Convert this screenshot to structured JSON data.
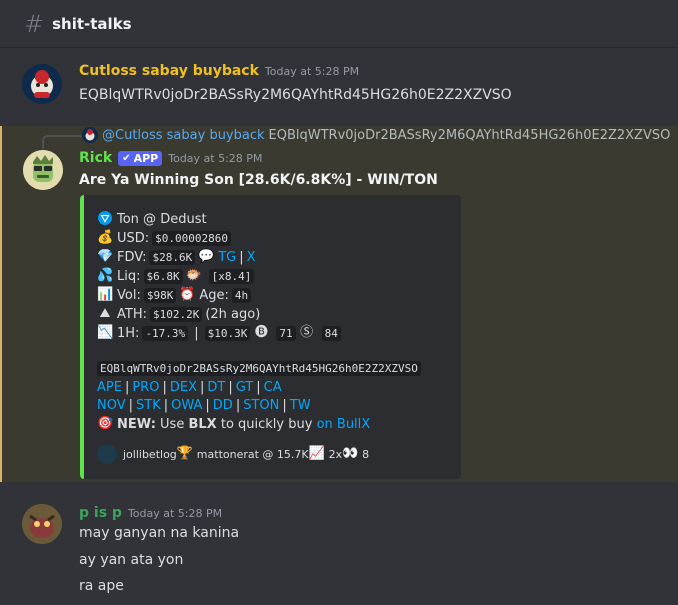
{
  "channel": {
    "name": "shit-talks",
    "icon": "hash-icon"
  },
  "messages": [
    {
      "author": "Cutloss sabay buyback",
      "author_color": "#f0c020",
      "timestamp": "Today at 5:28 PM",
      "content": "EQBlqWTRv0joDr2BASsRy2M6QAYhtRd45HG26h0E2Z2XZVSO"
    },
    {
      "reply": {
        "author": "@Cutloss sabay buyback",
        "text": "EQBlqWTRv0joDr2BASsRy2M6QAYhtRd45HG26h0E2Z2XZVSO"
      },
      "author": "Rick",
      "author_color": "#5ee34a",
      "badge": "APP",
      "timestamp": "Today at 5:28 PM",
      "title": "Are Ya Winning Son [28.6K/6.8K%] - WIN/TON",
      "embed": {
        "chain": "Ton @ Dedust",
        "usd_label": "USD:",
        "usd_value": "$0.00002860",
        "fdv_label": "FDV:",
        "fdv_value": "$28.6K",
        "fdv_links": [
          "TG",
          "X"
        ],
        "liq_label": "Liq:",
        "liq_value": "$6.8K",
        "liq_mult": "[x8.4]",
        "vol_label": "Vol:",
        "vol_value": "$98K",
        "age_label": "Age:",
        "age_value": "4h",
        "ath_label": "ATH:",
        "ath_value": "$102.2K",
        "ath_ago": "(2h ago)",
        "h1_label": "1H:",
        "h1_change": "-17.3%",
        "h1_vol": "$10.3K",
        "h1_buys": "71",
        "h1_sells": "84",
        "address": "EQBlqWTRv0joDr2BASsRy2M6QAYhtRd45HG26h0E2Z2XZVSO",
        "links_row1": [
          "APE",
          "PRO",
          "DEX",
          "DT",
          "GT",
          "CA"
        ],
        "links_row2": [
          "NOV",
          "STK",
          "OWA",
          "DD",
          "STON",
          "TW"
        ],
        "promo_new": "NEW:",
        "promo_use": "Use",
        "promo_blx": "BLX",
        "promo_rest": "to quickly buy",
        "promo_link": "on BullX",
        "footer": {
          "user1": "jollibetlog",
          "user2": "mattonerat @ 15.7K",
          "mult": "2x",
          "count": "8"
        }
      }
    },
    {
      "author": "p is p",
      "author_color": "#3ba55d",
      "timestamp": "Today at 5:28 PM",
      "lines": [
        "may ganyan na kanina",
        "ay yan ata yon",
        "ra ape"
      ]
    }
  ]
}
